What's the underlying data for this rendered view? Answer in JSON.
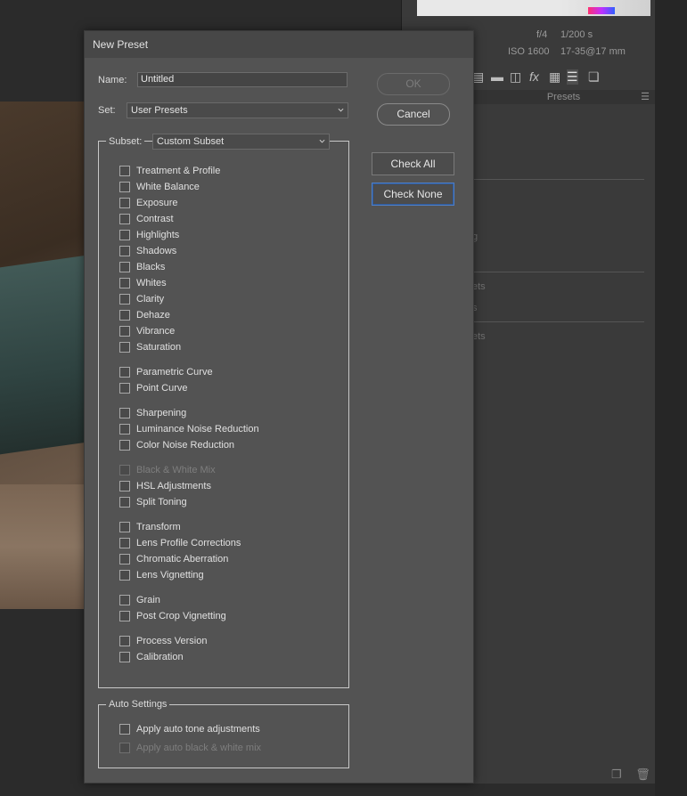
{
  "background": {
    "exif": {
      "aperture": "f/4",
      "shutter": "1/200 s",
      "iso": "ISO 1600",
      "lens": "17-35@17 mm"
    },
    "presets_panel_title": "Presets",
    "panel_fragments": [
      "g",
      "ets",
      "s",
      "ets"
    ]
  },
  "dialog": {
    "title": "New Preset",
    "name_label": "Name:",
    "name_value": "Untitled",
    "set_label": "Set:",
    "set_value": "User Presets",
    "ok_label": "OK",
    "cancel_label": "Cancel",
    "subset_label": "Subset:",
    "subset_value": "Custom Subset",
    "check_all_label": "Check All",
    "check_none_label": "Check None",
    "subset_items": [
      {
        "label": "Treatment & Profile",
        "checked": false,
        "enabled": true
      },
      {
        "label": "White Balance",
        "checked": false,
        "enabled": true
      },
      {
        "label": "Exposure",
        "checked": false,
        "enabled": true
      },
      {
        "label": "Contrast",
        "checked": false,
        "enabled": true
      },
      {
        "label": "Highlights",
        "checked": false,
        "enabled": true
      },
      {
        "label": "Shadows",
        "checked": false,
        "enabled": true
      },
      {
        "label": "Blacks",
        "checked": false,
        "enabled": true
      },
      {
        "label": "Whites",
        "checked": false,
        "enabled": true
      },
      {
        "label": "Clarity",
        "checked": false,
        "enabled": true
      },
      {
        "label": "Dehaze",
        "checked": false,
        "enabled": true
      },
      {
        "label": "Vibrance",
        "checked": false,
        "enabled": true
      },
      {
        "label": "Saturation",
        "checked": false,
        "enabled": true
      },
      {
        "label": "Parametric Curve",
        "checked": false,
        "enabled": true
      },
      {
        "label": "Point Curve",
        "checked": false,
        "enabled": true
      },
      {
        "label": "Sharpening",
        "checked": false,
        "enabled": true
      },
      {
        "label": "Luminance Noise Reduction",
        "checked": false,
        "enabled": true
      },
      {
        "label": "Color Noise Reduction",
        "checked": false,
        "enabled": true
      },
      {
        "label": "Black & White Mix",
        "checked": false,
        "enabled": false
      },
      {
        "label": "HSL Adjustments",
        "checked": false,
        "enabled": true
      },
      {
        "label": "Split Toning",
        "checked": false,
        "enabled": true
      },
      {
        "label": "Transform",
        "checked": false,
        "enabled": true
      },
      {
        "label": "Lens Profile Corrections",
        "checked": false,
        "enabled": true
      },
      {
        "label": "Chromatic Aberration",
        "checked": false,
        "enabled": true
      },
      {
        "label": "Lens Vignetting",
        "checked": false,
        "enabled": true
      },
      {
        "label": "Grain",
        "checked": false,
        "enabled": true
      },
      {
        "label": "Post Crop Vignetting",
        "checked": false,
        "enabled": true
      },
      {
        "label": "Process Version",
        "checked": false,
        "enabled": true
      },
      {
        "label": "Calibration",
        "checked": false,
        "enabled": true
      }
    ],
    "auto_settings_label": "Auto Settings",
    "auto_items": [
      {
        "label": "Apply auto tone adjustments",
        "checked": false,
        "enabled": true
      },
      {
        "label": "Apply auto black & white mix",
        "checked": false,
        "enabled": false
      }
    ]
  }
}
